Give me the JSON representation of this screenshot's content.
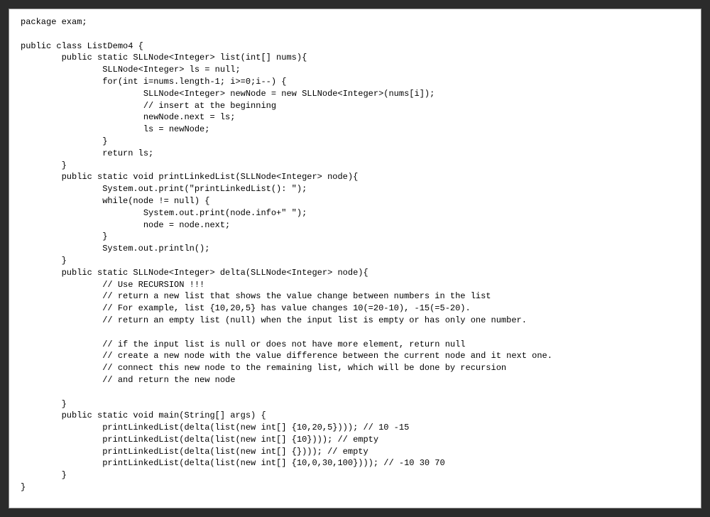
{
  "code": {
    "lines": [
      "package exam;",
      "",
      "public class ListDemo4 {",
      "        public static SLLNode<Integer> list(int[] nums){",
      "                SLLNode<Integer> ls = null;",
      "                for(int i=nums.length-1; i>=0;i--) {",
      "                        SLLNode<Integer> newNode = new SLLNode<Integer>(nums[i]);",
      "                        // insert at the beginning",
      "                        newNode.next = ls;",
      "                        ls = newNode;",
      "                }",
      "                return ls;",
      "        }",
      "        public static void printLinkedList(SLLNode<Integer> node){",
      "                System.out.print(\"printLinkedList(): \");",
      "                while(node != null) {",
      "                        System.out.print(node.info+\" \");",
      "                        node = node.next;",
      "                }",
      "                System.out.println();",
      "        }",
      "        public static SLLNode<Integer> delta(SLLNode<Integer> node){",
      "                // Use RECURSION !!!",
      "                // return a new list that shows the value change between numbers in the list",
      "                // For example, list {10,20,5} has value changes 10(=20-10), -15(=5-20).",
      "                // return an empty list (null) when the input list is empty or has only one number.",
      "",
      "                // if the input list is null or does not have more element, return null",
      "                // create a new node with the value difference between the current node and it next one.",
      "                // connect this new node to the remaining list, which will be done by recursion",
      "                // and return the new node",
      "",
      "        }",
      "        public static void main(String[] args) {",
      "                printLinkedList(delta(list(new int[] {10,20,5}))); // 10 -15",
      "                printLinkedList(delta(list(new int[] {10}))); // empty",
      "                printLinkedList(delta(list(new int[] {}))); // empty",
      "                printLinkedList(delta(list(new int[] {10,0,30,100}))); // -10 30 70",
      "        }",
      "}"
    ]
  }
}
